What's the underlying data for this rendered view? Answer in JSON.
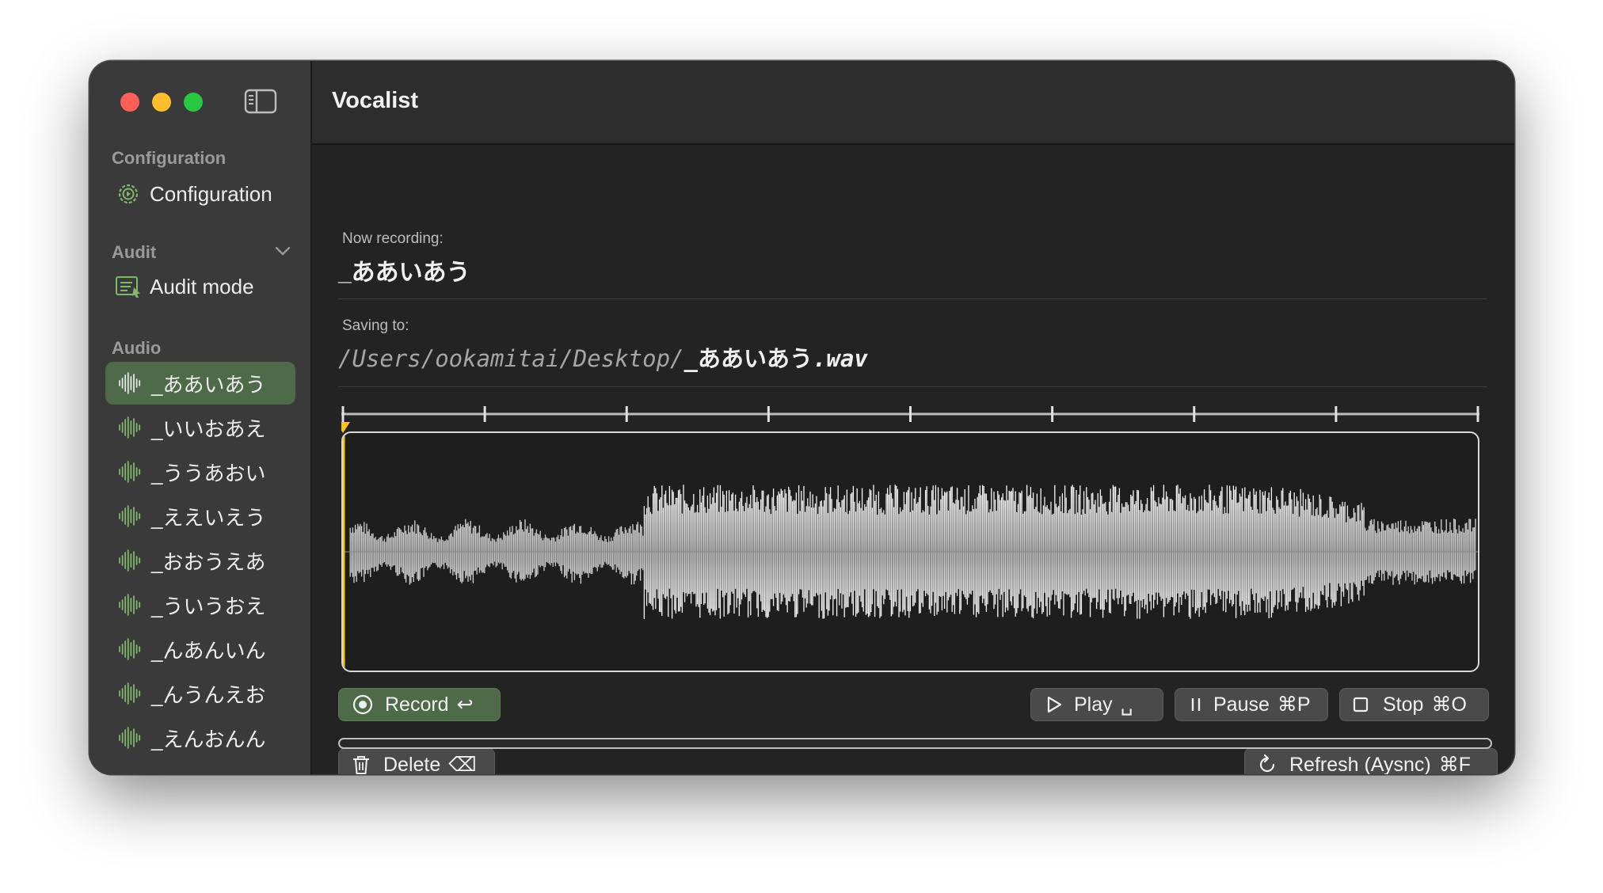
{
  "window": {
    "title": "Vocalist"
  },
  "sidebar": {
    "sections": {
      "configuration": "Configuration",
      "audit": "Audit",
      "audio": "Audio"
    },
    "configuration_item": "Configuration",
    "audit_item": "Audit mode",
    "audio_items": [
      {
        "label": "_ああいあう",
        "selected": true
      },
      {
        "label": "_いいおあえ"
      },
      {
        "label": "_ううあおい"
      },
      {
        "label": "_ええいえう"
      },
      {
        "label": "_おおうえあ"
      },
      {
        "label": "_ういうおえ"
      },
      {
        "label": "_んあんいん"
      },
      {
        "label": "_んうんえお"
      },
      {
        "label": "_えんおんん"
      }
    ]
  },
  "recording": {
    "now_label": "Now recording:",
    "now_value": "_ああいあう",
    "saving_label": "Saving to:",
    "path_dir": "/Users/ookamitai/Desktop/",
    "path_name": "_ああいあう",
    "path_ext": ".wav"
  },
  "controls": {
    "record": {
      "label": "Record",
      "shortcut": "↩"
    },
    "play": {
      "label": "Play",
      "shortcut": "␣"
    },
    "pause": {
      "label": "Pause",
      "shortcut": "⌘P"
    },
    "stop": {
      "label": "Stop",
      "shortcut": "⌘O"
    },
    "delete": {
      "label": "Delete",
      "shortcut": "⌫"
    },
    "refresh": {
      "label": "Refresh (Aysnc)",
      "shortcut": "⌘F"
    }
  },
  "waveform": {
    "playhead_fraction": 0.0,
    "progress_fraction": 0.0
  },
  "colors": {
    "accent_green": "#4f6a48",
    "playhead": "#f5c518",
    "icon_green": "#7fb86d"
  },
  "icons": {
    "sidebar_toggle": "sidebar-toggle-icon",
    "configuration": "gear-icon",
    "audit": "audit-list-icon",
    "audio": "waveform-icon"
  }
}
